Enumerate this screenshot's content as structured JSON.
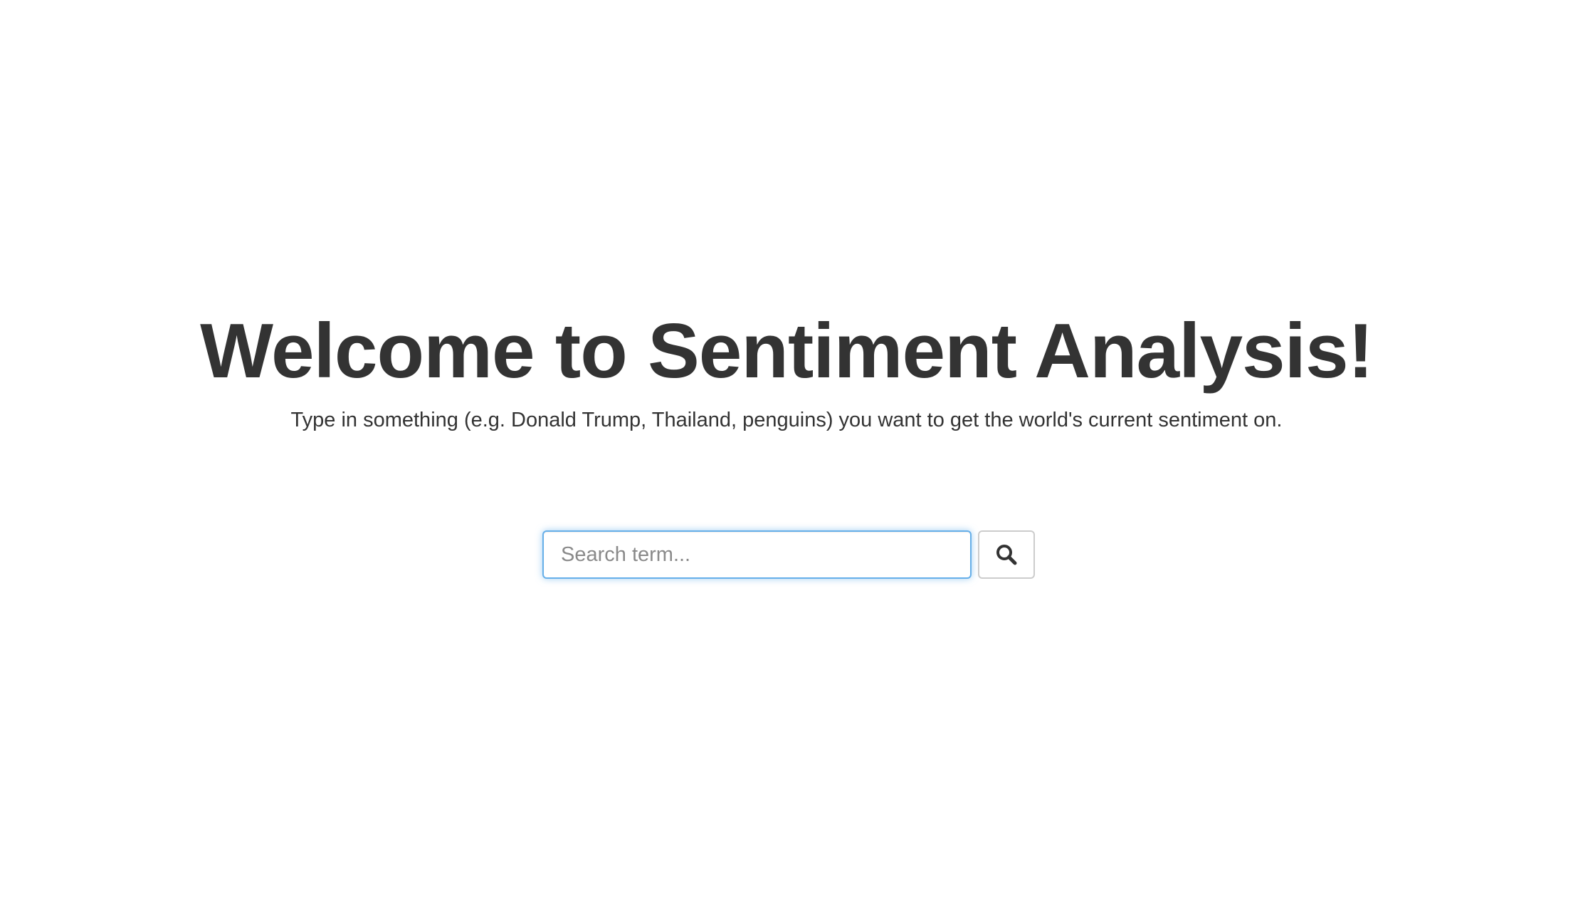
{
  "hero": {
    "title": "Welcome to Sentiment Analysis!",
    "subtitle": "Type in something (e.g. Donald Trump, Thailand, penguins) you want to get the world's current sentiment on."
  },
  "search": {
    "value": "",
    "placeholder": "Search term...",
    "button_icon": "search-icon"
  },
  "colors": {
    "text": "#333333",
    "focus_border": "#66afe9",
    "button_border": "#cccccc",
    "background": "#ffffff"
  }
}
